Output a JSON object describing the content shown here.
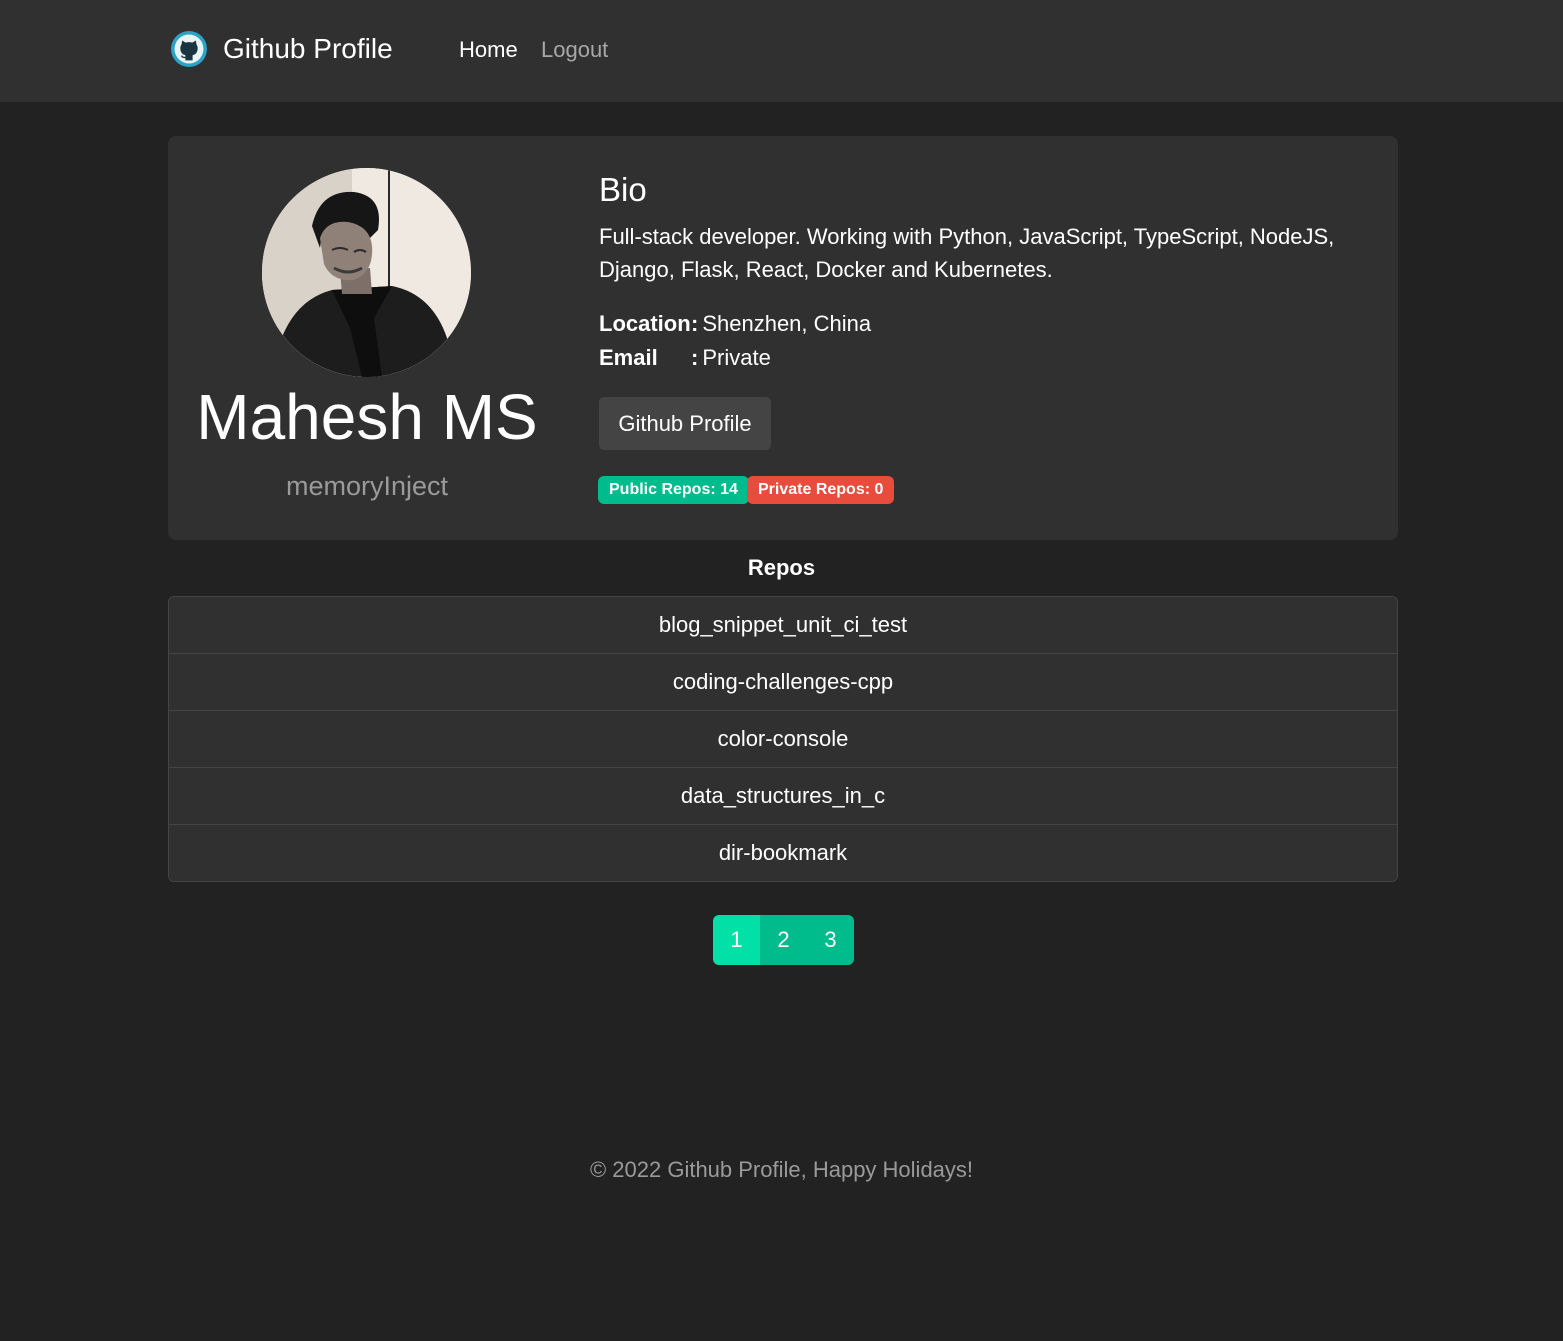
{
  "navbar": {
    "brand": "Github Profile",
    "brand_icon": "github-octocat-icon",
    "links": [
      {
        "label": "Home",
        "active": true
      },
      {
        "label": "Logout",
        "active": false
      }
    ]
  },
  "profile": {
    "avatar": "user-avatar-photo",
    "name": "Mahesh MS",
    "username": "memoryInject",
    "bio_title": "Bio",
    "bio": "Full-stack developer. Working with Python, JavaScript, TypeScript, NodeJS, Django, Flask, React, Docker and Kubernetes.",
    "location_label": "Location",
    "location": "Shenzhen, China",
    "email_label": "Email",
    "email": "Private",
    "separator": ":",
    "github_button": "Github Profile",
    "public_repos": "Public Repos: 14",
    "private_repos": "Private Repos: 0"
  },
  "repos": {
    "title": "Repos",
    "items": [
      "blog_snippet_unit_ci_test",
      "coding-challenges-cpp",
      "color-console",
      "data_structures_in_c",
      "dir-bookmark"
    ]
  },
  "pagination": {
    "pages": [
      "1",
      "2",
      "3"
    ],
    "current": "1"
  },
  "footer": {
    "text": "© 2022 Github Profile, Happy Holidays!"
  },
  "colors": {
    "background": "#222222",
    "surface": "#303030",
    "success": "#00bc8c",
    "danger": "#e74c3c",
    "muted": "#9a9a9a"
  }
}
